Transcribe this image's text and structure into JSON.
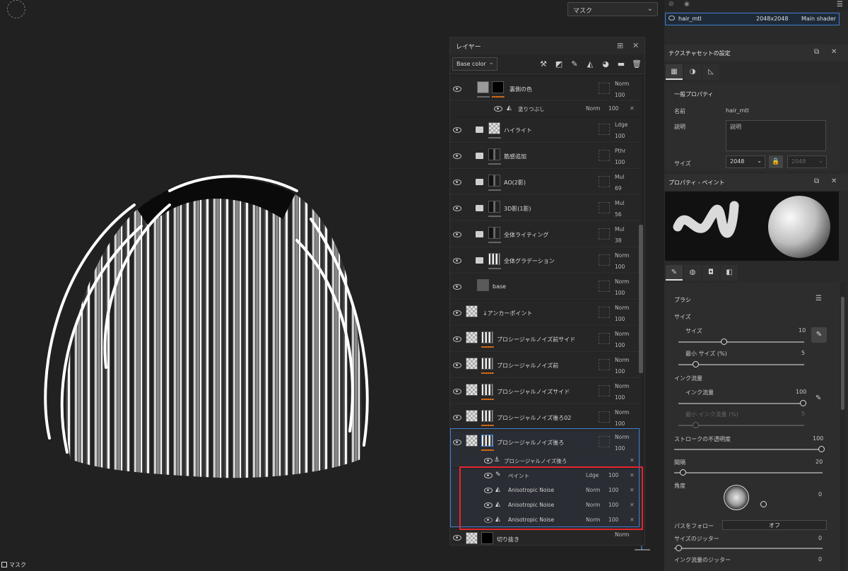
{
  "viewport": {
    "mask_select": "マスク",
    "bottom_label": "マスク"
  },
  "layers_panel": {
    "title": "レイヤー",
    "channel": "Base color",
    "layers": [
      {
        "name": "裏側の色",
        "blend": "Norm",
        "opacity": "100"
      },
      {
        "name": "ハイライト",
        "blend": "Ldge",
        "opacity": "100"
      },
      {
        "name": "筋感追加",
        "blend": "Pthr",
        "opacity": "100"
      },
      {
        "name": "AO(2影)",
        "blend": "Mul",
        "opacity": "69"
      },
      {
        "name": "3D影(1影)",
        "blend": "Mul",
        "opacity": "56"
      },
      {
        "name": "全体ライティング",
        "blend": "Mul",
        "opacity": "38"
      },
      {
        "name": "全体グラデーション",
        "blend": "Norm",
        "opacity": "100"
      },
      {
        "name": "base",
        "blend": "Norm",
        "opacity": "100"
      },
      {
        "name": "↓アンカーポイント",
        "blend": "Norm",
        "opacity": "100"
      },
      {
        "name": "プロシージャルノイズ前サイド",
        "blend": "Norm",
        "opacity": "100"
      },
      {
        "name": "プロシージャルノイズ前",
        "blend": "Norm",
        "opacity": "100"
      },
      {
        "name": "プロシージャルノイズサイド",
        "blend": "Norm",
        "opacity": "100"
      },
      {
        "name": "プロシージャルノイズ後ろ02",
        "blend": "Norm",
        "opacity": "100"
      },
      {
        "name": "プロシージャルノイズ後ろ",
        "blend": "Norm",
        "opacity": "100"
      },
      {
        "name": "切り抜き",
        "blend": "Norm",
        "opacity": ""
      }
    ],
    "fill_effect": {
      "name": "塗りつぶし",
      "blend": "Norm",
      "opacity": "100"
    },
    "anchor_effect": {
      "name": "プロシージャルノイズ後ろ"
    },
    "sub_effects": [
      {
        "name": "ペイント",
        "blend": "Ldge",
        "opacity": "100"
      },
      {
        "name": "Anisotropic Noise",
        "blend": "Norm",
        "opacity": "100"
      },
      {
        "name": "Anisotropic Noise",
        "blend": "Norm",
        "opacity": "100"
      },
      {
        "name": "Anisotropic Noise",
        "blend": "Norm",
        "opacity": "100"
      }
    ]
  },
  "texture_set_list": {
    "name": "hair_mtl",
    "size": "2048x2048",
    "shader": "Main shader"
  },
  "texture_set_settings": {
    "title": "テクスチャセットの設定",
    "section": "一般プロパティ",
    "name_label": "名前",
    "name_value": "hair_mtl",
    "desc_label": "説明",
    "desc_placeholder": "説明",
    "size_label": "サイズ",
    "size_value": "2048",
    "size_value_locked": "2048"
  },
  "paint_props": {
    "title": "プロパティ - ペイント",
    "brush_title": "ブラシ",
    "size_group": "サイズ",
    "size_label": "サイズ",
    "size_value": "10",
    "min_size_label": "最小 サイズ (%)",
    "min_size_value": "5",
    "flow_group": "インク流量",
    "flow_label": "インク流量",
    "flow_value": "100",
    "min_flow_label": "最小 インク流量 (%)",
    "min_flow_value": "5",
    "stroke_opacity_label": "ストロークの不透明度",
    "stroke_opacity_value": "100",
    "spacing_label": "間隔",
    "spacing_value": "20",
    "angle_label": "角度",
    "angle_value": "0",
    "follow_path_label": "パスをフォロー",
    "follow_path_value": "オフ",
    "size_jitter_label": "サイズのジッター",
    "size_jitter_value": "0",
    "flow_jitter_label": "インク流量のジッター",
    "flow_jitter_value": "0"
  },
  "colors": {
    "accent_blue": "#3f7fd0",
    "highlight_red": "#e8242f",
    "orange_bar": "#e0701a"
  }
}
